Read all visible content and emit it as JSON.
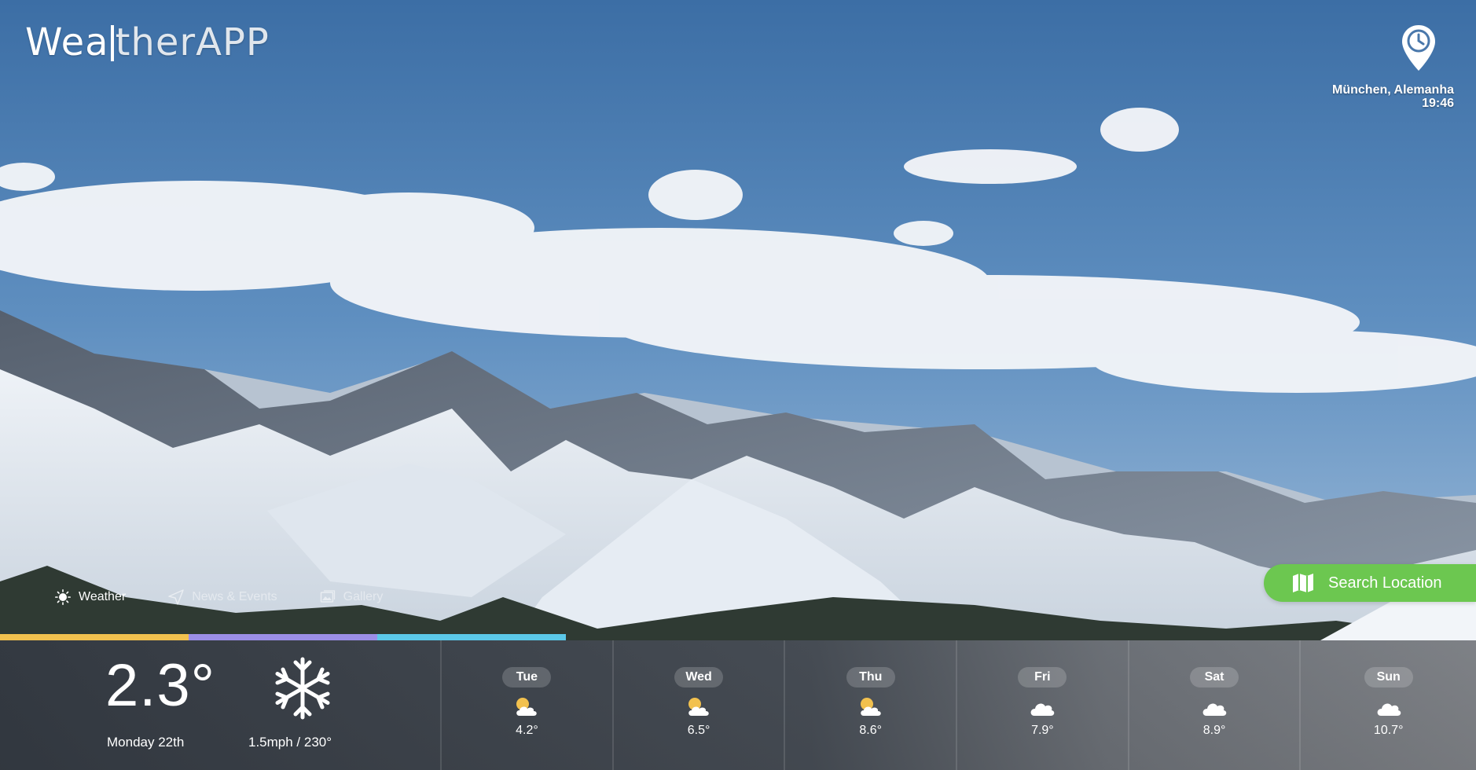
{
  "brand": {
    "logo_part1": "Wea",
    "logo_part2": "therAPP"
  },
  "location": {
    "place": "München, Alemanha",
    "time": "19:46",
    "icon": "location-clock-pin-icon"
  },
  "nav": [
    {
      "label": "Weather",
      "icon": "sun-icon",
      "active": true
    },
    {
      "label": "News & Events",
      "icon": "paper-plane-icon",
      "active": false
    },
    {
      "label": "Gallery",
      "icon": "image-icon",
      "active": false
    }
  ],
  "search": {
    "label": "Search Location",
    "icon": "map-icon"
  },
  "tab_colors": [
    "#f2c14e",
    "#9b8ee6",
    "#5bc8e8"
  ],
  "current": {
    "temperature": "2.3°",
    "date": "Monday 22th",
    "wind": "1.5mph / 230°",
    "icon": "snowflake-icon"
  },
  "forecast": [
    {
      "day": "Tue",
      "temp": "4.2°",
      "icon": "sun-cloud-icon"
    },
    {
      "day": "Wed",
      "temp": "6.5°",
      "icon": "sun-cloud-icon"
    },
    {
      "day": "Thu",
      "temp": "8.6°",
      "icon": "sun-cloud-icon"
    },
    {
      "day": "Fri",
      "temp": "7.9°",
      "icon": "cloud-icon"
    },
    {
      "day": "Sat",
      "temp": "8.9°",
      "icon": "cloud-icon"
    },
    {
      "day": "Sun",
      "temp": "10.7°",
      "icon": "cloud-icon"
    }
  ],
  "colors": {
    "search_green": "#6cc750",
    "sun_yellow": "#f2c14e"
  }
}
